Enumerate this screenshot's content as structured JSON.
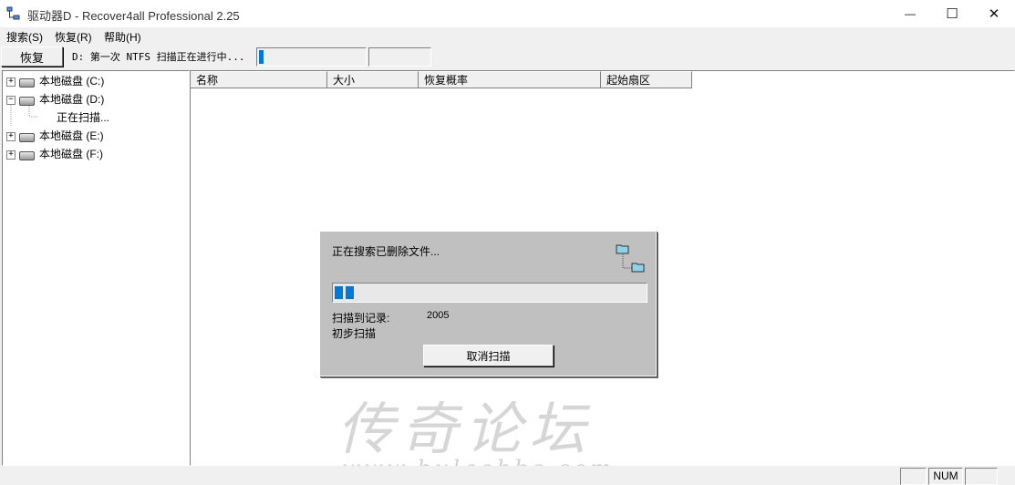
{
  "window": {
    "title": "驱动器D - Recover4all Professional 2.25",
    "minimize_glyph": "—",
    "maximize_glyph": "☐",
    "close_glyph": "✕"
  },
  "menu": [
    {
      "label": "搜索(S)"
    },
    {
      "label": "恢复(R)"
    },
    {
      "label": "帮助(H)"
    }
  ],
  "toolbar": {
    "recover_label": "恢复",
    "status_text": "D: 第一次 NTFS 扫描正在进行中...",
    "progress_fraction": 0.04
  },
  "tree": {
    "items": [
      {
        "label": "本地磁盘 (C:)",
        "expander": "+",
        "icon": "drive-icon"
      },
      {
        "label": "本地磁盘 (D:)",
        "expander": "−",
        "icon": "drive-icon"
      },
      {
        "label": "正在扫描...",
        "expander": "",
        "icon": ""
      },
      {
        "label": "本地磁盘 (E:)",
        "expander": "+",
        "icon": "drive-icon"
      },
      {
        "label": "本地磁盘 (F:)",
        "expander": "+",
        "icon": "drive-icon"
      }
    ]
  },
  "list": {
    "columns": [
      "名称",
      "大小",
      "恢复概率",
      "起始扇区"
    ]
  },
  "dialog": {
    "message": "正在搜索已删除文件...",
    "progress_segments": 2,
    "records_label": "扫描到记录:",
    "records_value": "2005",
    "phase": "初步扫描",
    "cancel_label": "取消扫描",
    "icon": "folder-tree-icon"
  },
  "statusbar": {
    "num": "NUM"
  },
  "watermark": {
    "text": "传奇论坛",
    "url": "www.bulaobbs.com"
  },
  "colors": {
    "progress": "#0078d7",
    "dialog_bg": "#c0c0c0",
    "folder": "#8fd3e8"
  }
}
